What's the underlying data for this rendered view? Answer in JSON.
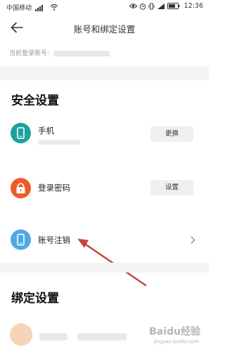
{
  "status_bar": {
    "carrier": "中国移动",
    "time": "12:36",
    "battery_level_percent": 75
  },
  "header": {
    "title": "账号和绑定设置"
  },
  "account": {
    "label": "当前登录账号:"
  },
  "sections": {
    "security_title": "安全设置",
    "binding_title": "绑定设置"
  },
  "security_items": {
    "phone": {
      "label": "手机",
      "button": "更换",
      "icon": "phone-icon",
      "color": "#1aa49a"
    },
    "password": {
      "label": "登录密码",
      "button": "设置",
      "icon": "lock-icon",
      "color": "#f05a28"
    },
    "cancel": {
      "label": "账号注销",
      "icon": "phone-icon",
      "color": "#4fa8e6"
    }
  },
  "annotation": {
    "arrow_color": "#c9443f"
  },
  "watermark": {
    "text": "Baidu经验",
    "sub": "jingyan.baidu.com"
  }
}
